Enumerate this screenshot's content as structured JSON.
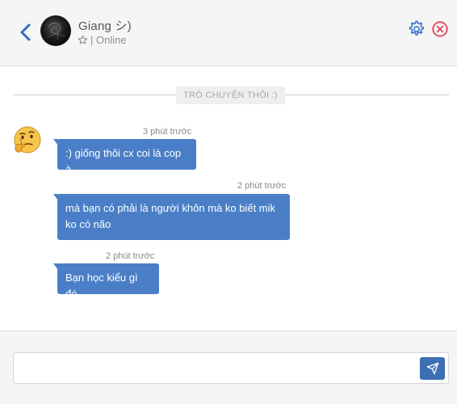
{
  "header": {
    "back_icon": "chevron-left-icon",
    "avatar": "user-avatar",
    "name": "Giang シ)",
    "status_star_icon": "star-outline-icon",
    "status": "| Online",
    "settings_icon": "gear-icon",
    "close_icon": "close-circle-icon",
    "accent_color": "#2f6fc6",
    "close_color": "#e0475a"
  },
  "chat": {
    "divider_label": "TRÒ CHUYỆN THÔI :)",
    "sender_avatar_icon": "thinking-face-emoji",
    "messages": [
      {
        "time": "3 phút trước",
        "text": ":) giống thôi cx coi là cop à"
      },
      {
        "time": "2 phút trước",
        "text": "mà bạn có phải là người khôn mà ko biết mik ko có não"
      },
      {
        "time": "2 phút trước",
        "text": "Bạn học kiểu gì đó"
      }
    ],
    "bubble_color": "#4a7fc7"
  },
  "composer": {
    "input_value": "",
    "input_placeholder": "",
    "send_icon": "paper-plane-icon",
    "send_color": "#3d6fb3"
  }
}
